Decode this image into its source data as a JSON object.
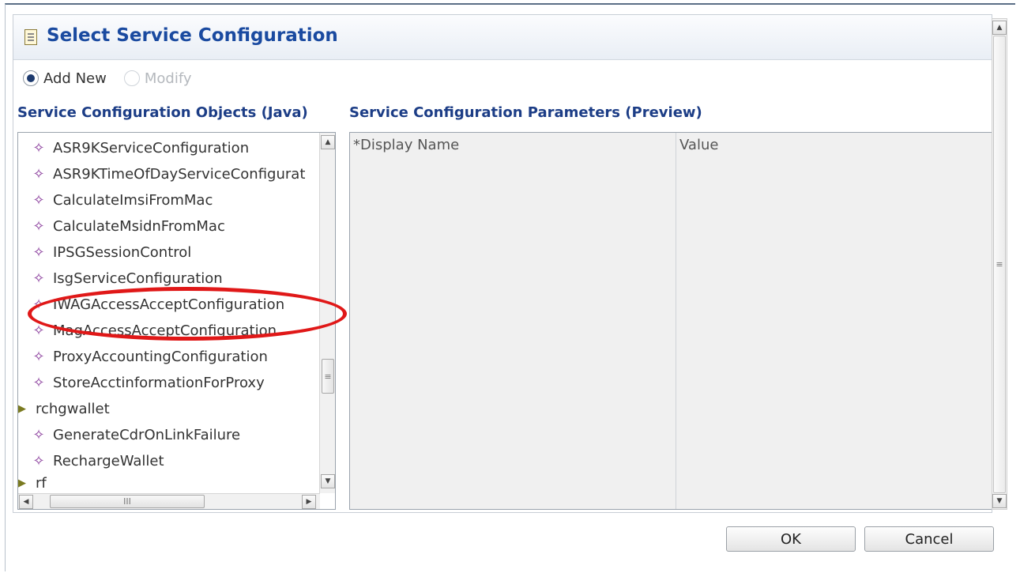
{
  "dialog": {
    "title": "Select Service Configuration",
    "mode": {
      "add_new": "Add New",
      "modify": "Modify",
      "selected": "Add New"
    }
  },
  "objects_pane": {
    "heading": "Service Configuration Objects (Java)",
    "items": [
      {
        "label": "ASR9KServiceConfiguration",
        "kind": "leaf"
      },
      {
        "label": "ASR9KTimeOfDayServiceConfigurat",
        "kind": "leaf"
      },
      {
        "label": "CalculateImsiFromMac",
        "kind": "leaf"
      },
      {
        "label": "CalculateMsidnFromMac",
        "kind": "leaf"
      },
      {
        "label": "IPSGSessionControl",
        "kind": "leaf"
      },
      {
        "label": "IsgServiceConfiguration",
        "kind": "leaf"
      },
      {
        "label": "IWAGAccessAcceptConfiguration",
        "kind": "leaf",
        "highlighted": true
      },
      {
        "label": "MagAccessAcceptConfiguration",
        "kind": "leaf"
      },
      {
        "label": "ProxyAccountingConfiguration",
        "kind": "leaf"
      },
      {
        "label": "StoreAcctinformationForProxy",
        "kind": "leaf"
      },
      {
        "label": "rchgwallet",
        "kind": "folder"
      },
      {
        "label": "GenerateCdrOnLinkFailure",
        "kind": "leaf"
      },
      {
        "label": "RechargeWallet",
        "kind": "leaf"
      },
      {
        "label": "rf",
        "kind": "folder"
      }
    ],
    "scrollbar_thumb_glyph": "≡",
    "hscroll_thumb_glyph": "III"
  },
  "parameters_pane": {
    "heading": "Service Configuration Parameters (Preview)",
    "columns": [
      "*Display Name",
      "Value"
    ]
  },
  "buttons": {
    "ok": "OK",
    "cancel": "Cancel"
  },
  "colors": {
    "title": "#1a4aa0",
    "section_heading": "#1c3d86",
    "leaf_icon": "#8a3d9c",
    "annotation": "#e01818"
  }
}
